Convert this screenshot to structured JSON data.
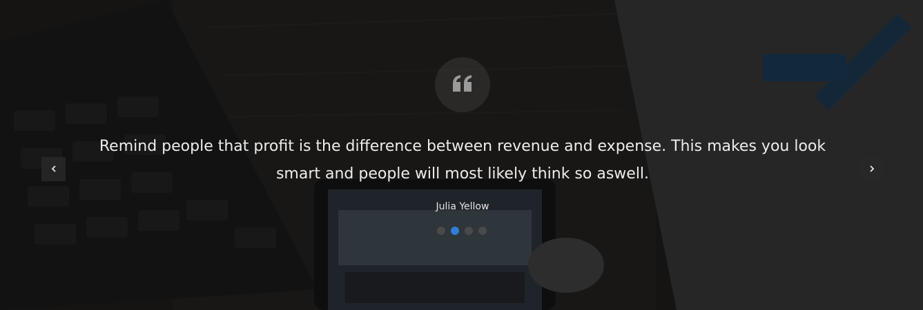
{
  "testimonial": {
    "quote": "Remind people that profit is the difference between revenue and expense. This makes you look smart and people will most likely think so aswell.",
    "author": "Julia Yellow",
    "active_slide": 2,
    "slide_count": 4
  },
  "icons": {
    "quote": "quote-left-icon",
    "prev": "chevron-left-icon",
    "next": "chevron-right-icon"
  },
  "colors": {
    "accent": "#2f7fd6",
    "dot_inactive": "#4a4a4a",
    "text": "#ededed",
    "overlay": "#0a0a0a"
  }
}
